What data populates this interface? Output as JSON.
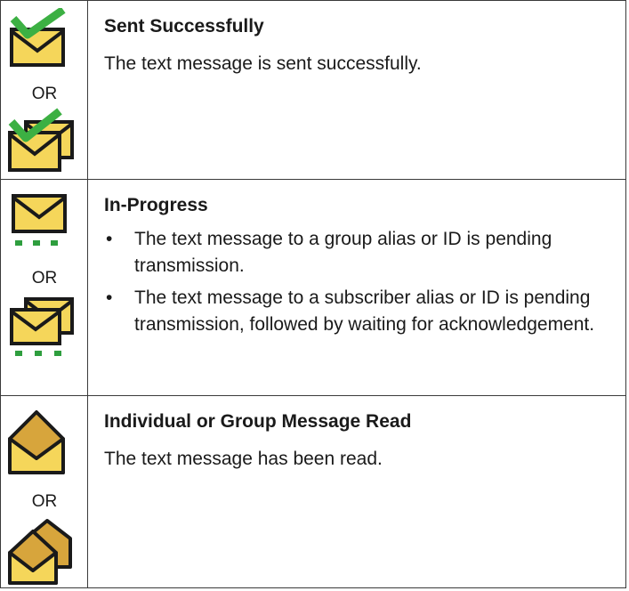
{
  "rows": [
    {
      "heading": "Sent Successfully",
      "description": "The text message is sent successfully.",
      "or_label": "OR",
      "icons": [
        "envelope-check-icon",
        "envelopes-check-icon"
      ]
    },
    {
      "heading": "In-Progress",
      "bullets": [
        "The text message to a group alias or ID is pending transmission.",
        "The text message to a subscriber alias or ID is pending transmission, followed by waiting for acknowledgement."
      ],
      "bullet_symbol": "•",
      "or_label": "OR",
      "icons": [
        "envelope-pending-icon",
        "envelopes-pending-icon"
      ]
    },
    {
      "heading": "Individual or Group Message Read",
      "description": "The text message has been read.",
      "or_label": "OR",
      "icons": [
        "envelope-open-icon",
        "envelopes-open-icon"
      ]
    }
  ],
  "colors": {
    "envelope_fill": "#f5d65a",
    "envelope_stroke": "#1a1a1a",
    "check": "#3cb043",
    "dots": "#2e9e3e",
    "open_fill": "#d7a53c"
  }
}
